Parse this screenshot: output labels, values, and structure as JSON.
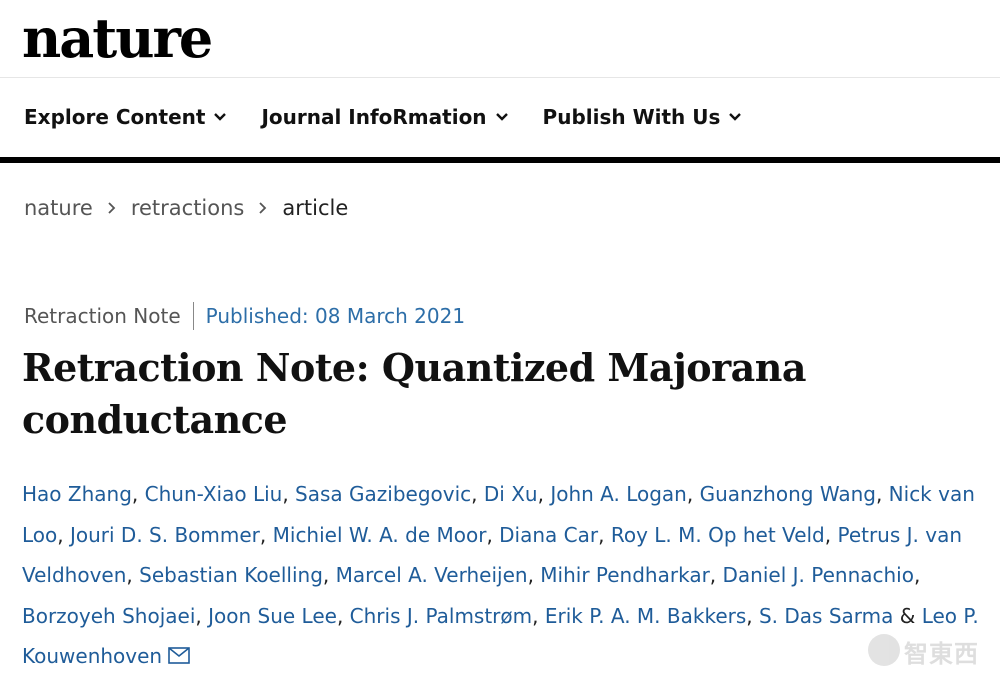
{
  "site": {
    "logo_text": "nature"
  },
  "nav": {
    "items": [
      {
        "label": "Explore Content"
      },
      {
        "label": "Journal InfoRmation"
      },
      {
        "label": "Publish With Us"
      }
    ]
  },
  "breadcrumb": {
    "items": [
      "nature",
      "retractions",
      "article"
    ]
  },
  "article": {
    "type": "Retraction Note",
    "published": "Published: 08 March 2021",
    "title": "Retraction Note: Quantized Majorana conductance",
    "authors": [
      "Hao Zhang",
      "Chun-Xiao Liu",
      "Sasa Gazibegovic",
      "Di Xu",
      "John A. Logan",
      "Guanzhong Wang",
      "Nick van Loo",
      "Jouri D. S. Bommer",
      "Michiel W. A. de Moor",
      "Diana Car",
      "Roy L. M. Op het Veld",
      "Petrus J. van Veldhoven",
      "Sebastian Koelling",
      "Marcel A. Verheijen",
      "Mihir Pendharkar",
      "Daniel J. Pennachio",
      "Borzoyeh Shojaei",
      "Joon Sue Lee",
      "Chris J. Palmstrøm",
      "Erik P. A. M. Bakkers",
      "S. Das Sarma",
      "Leo P. Kouwenhoven"
    ],
    "author_separator": ", ",
    "last_separator": " & ",
    "corresponding_icon": "mail-icon"
  },
  "watermark": {
    "text": "智東西",
    "icon": "watermark-logo-icon"
  },
  "colors": {
    "link_blue": "#1f5c99",
    "published_blue": "#2d6ea8",
    "nav_border": "#000000"
  }
}
